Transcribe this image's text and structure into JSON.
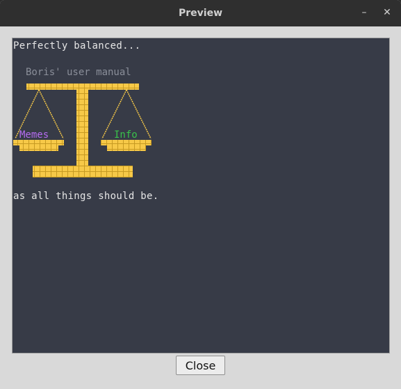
{
  "window": {
    "title": "Preview",
    "minimize_glyph": "–",
    "close_glyph": "✕"
  },
  "terminal": {
    "line_top": "Perfectly balanced...",
    "manual_caption": "Boris' user manual",
    "left_pan_label": "Memes",
    "right_pan_label": "Info",
    "line_bottom": "as all things should be."
  },
  "colors": {
    "terminal_bg": "#373b47",
    "scale_yellow": "#f7c948",
    "caption_gray": "#8a8e99",
    "memes_purple": "#b56cf0",
    "info_green": "#39c24a"
  },
  "footer": {
    "close_label": "Close"
  }
}
